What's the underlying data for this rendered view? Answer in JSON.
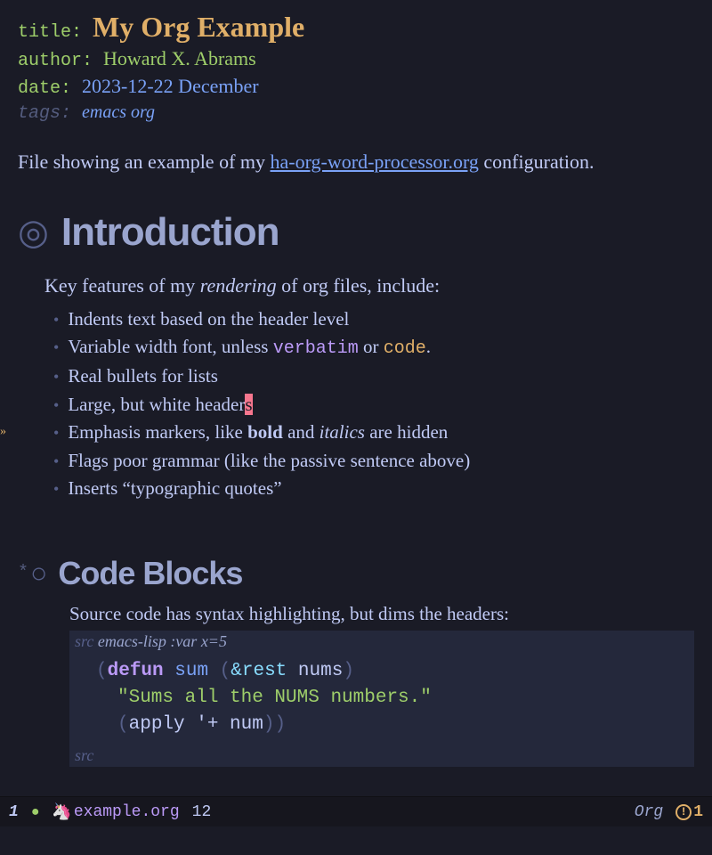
{
  "meta": {
    "title_key": "title:",
    "title_value": "My Org Example",
    "author_key": "author:",
    "author_value": "Howard X. Abrams",
    "date_key": "date:",
    "date_value": "2023-12-22 December",
    "tags_key": "tags:",
    "tags_value": "emacs org"
  },
  "intro": {
    "before_link": "File showing an example of my ",
    "link_text": "ha-org-word-processor.org",
    "after_link": " configuration."
  },
  "section1": {
    "heading": "Introduction",
    "lead_before": "Key features of my ",
    "lead_em": "rendering",
    "lead_after": " of org files, include:",
    "items": [
      {
        "text": "Indents text based on the header level"
      },
      {
        "before": "Variable width font, unless ",
        "verbatim": "verbatim",
        "mid": " or ",
        "code": "code",
        "after": "."
      },
      {
        "text": "Real bullets for lists"
      },
      {
        "before": "Large, but white header",
        "cursor": "s"
      },
      {
        "before": "Emphasis markers, like ",
        "bold": "bold",
        "mid": " and ",
        "italic": "italics",
        "after": " are hidden"
      },
      {
        "text": "Flags poor grammar (like the passive sentence above)"
      },
      {
        "text": "Inserts “typographic quotes”"
      }
    ],
    "fringe": "»"
  },
  "section2": {
    "star": "*",
    "heading": "Code Blocks",
    "para": "Source code has syntax highlighting, but dims the headers:",
    "src_label": "src ",
    "src_lang": "emacs-lisp ",
    "src_var": ":var x=5",
    "code": {
      "l1_paren1": "(",
      "l1_kw": "defun",
      "l1_sp1": " ",
      "l1_name": "sum",
      "l1_sp2": " ",
      "l1_paren2": "(",
      "l1_rest": "&rest",
      "l1_sp3": " ",
      "l1_param": "nums",
      "l1_paren3": ")",
      "l2_str": "\"Sums all the NUMS numbers.\"",
      "l3_paren1": "(",
      "l3_apply": "apply ",
      "l3_quote": "'+ num",
      "l3_paren2": "))"
    },
    "src_end": "src"
  },
  "modeline": {
    "winnum": "1",
    "dot": "●",
    "unicorn": "🦄",
    "filename": "example.org",
    "line": "12",
    "mode": "Org",
    "warn_icon": "!",
    "warn_count": "1"
  }
}
